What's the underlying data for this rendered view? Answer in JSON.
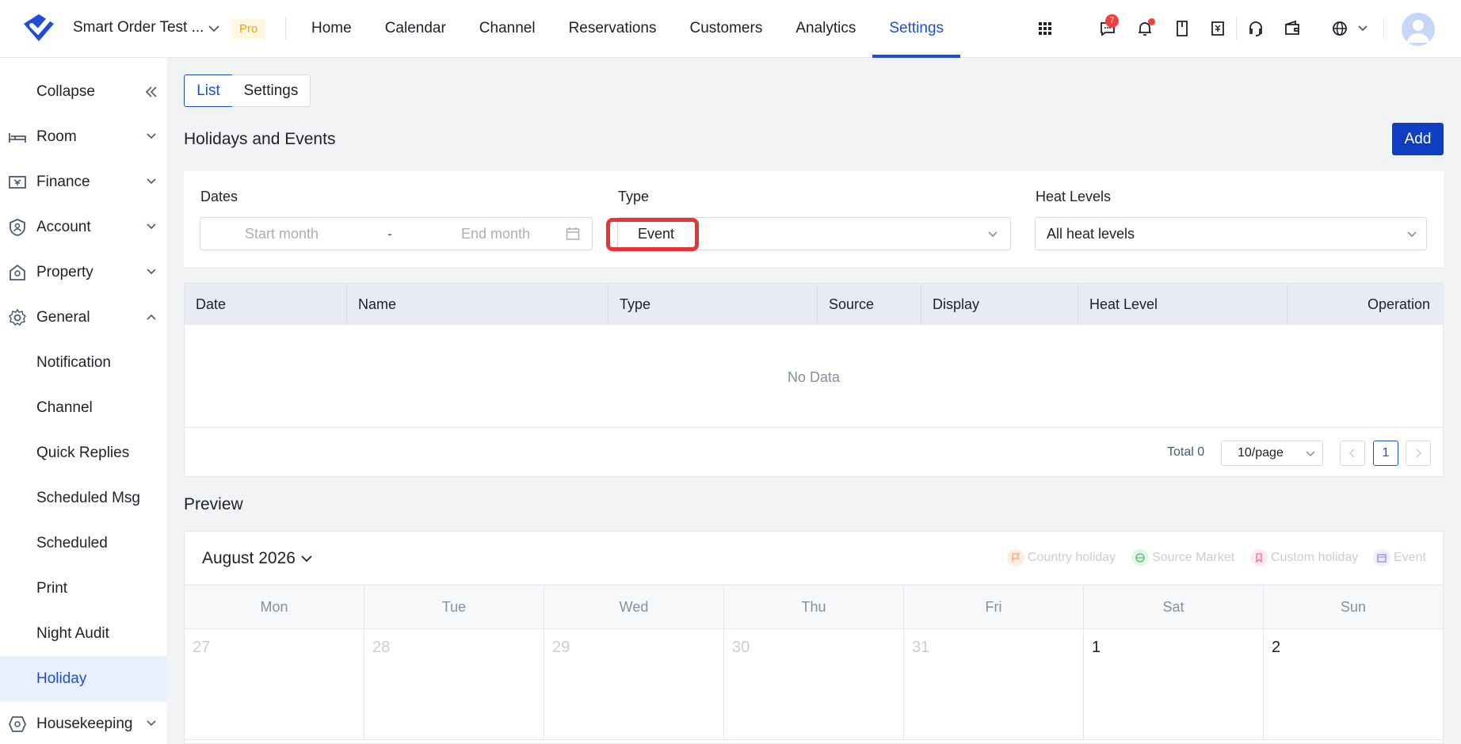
{
  "header": {
    "hotel_name": "Smart Order Test ...",
    "badge": "Pro",
    "nav": [
      "Home",
      "Calendar",
      "Channel",
      "Reservations",
      "Customers",
      "Analytics",
      "Settings"
    ],
    "active_nav": "Settings",
    "message_count": "7",
    "accent_color": "#1f4dd6"
  },
  "sidebar": {
    "collapse": "Collapse",
    "items": [
      {
        "label": "Room",
        "icon": "bed-icon"
      },
      {
        "label": "Finance",
        "icon": "finance-icon"
      },
      {
        "label": "Account",
        "icon": "account-shield-icon"
      },
      {
        "label": "Property",
        "icon": "property-icon"
      },
      {
        "label": "General",
        "icon": "gear-icon"
      }
    ],
    "sub_items": [
      "Notification",
      "Channel",
      "Quick Replies",
      "Scheduled Msg",
      "Scheduled",
      "Print",
      "Night Audit",
      "Holiday"
    ],
    "active": "Holiday",
    "housekeeping": "Housekeeping"
  },
  "tabs": {
    "list": "List",
    "settings": "Settings"
  },
  "page": {
    "title": "Holidays and Events",
    "add_label": "Add"
  },
  "filters": {
    "dates_label": "Dates",
    "start_placeholder": "Start month",
    "separator": "-",
    "end_placeholder": "End month",
    "type_label": "Type",
    "type_value": "Event",
    "heat_label": "Heat Levels",
    "heat_value": "All heat levels"
  },
  "table": {
    "columns": [
      "Date",
      "Name",
      "Type",
      "Source",
      "Display",
      "Heat Level",
      "Operation"
    ],
    "empty_text": "No Data",
    "total": "Total 0",
    "page_size": "10/page",
    "current_page": "1"
  },
  "preview": {
    "title": "Preview",
    "month": "August 2026",
    "legend": [
      {
        "label": "Country holiday",
        "color": "#f7a46b"
      },
      {
        "label": "Source Market",
        "color": "#3fbf6f"
      },
      {
        "label": "Custom holiday",
        "color": "#f0709a"
      },
      {
        "label": "Event",
        "color": "#9b8ae8"
      }
    ],
    "weekdays": [
      "Mon",
      "Tue",
      "Wed",
      "Thu",
      "Fri",
      "Sat",
      "Sun"
    ],
    "days": [
      "27",
      "28",
      "29",
      "30",
      "31",
      "1",
      "2"
    ]
  }
}
